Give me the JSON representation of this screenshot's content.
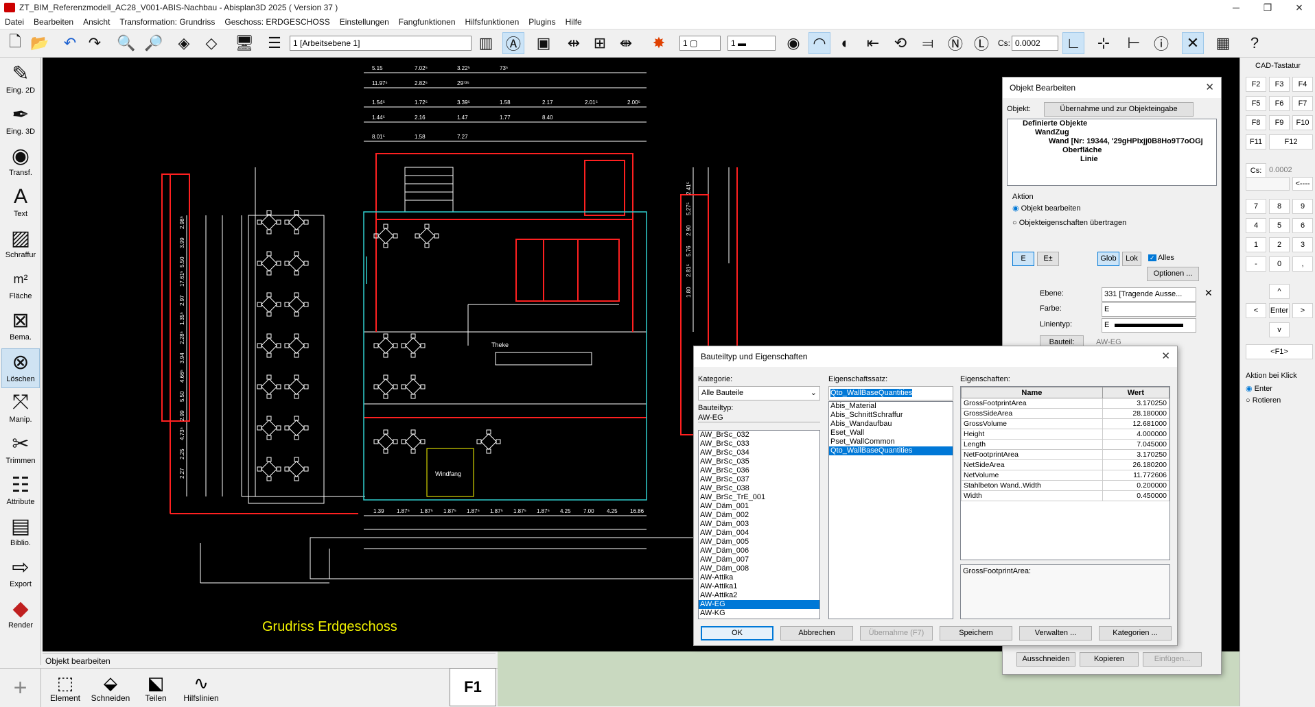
{
  "window": {
    "title": "ZT_BIM_Referenzmodell_AC28_V001-ABIS-Nachbau - Abisplan3D 2025 ( Version 37 )"
  },
  "menu": [
    "Datei",
    "Bearbeiten",
    "Ansicht",
    "Transformation: Grundriss",
    "Geschoss: ERDGESCHOSS",
    "Einstellungen",
    "Fangfunktionen",
    "Hilfsfunktionen",
    "Plugins",
    "Hilfe"
  ],
  "toolbar": {
    "layer_select": "1 [Arbeitsebene 1]",
    "pen_value": "1",
    "line_value": "1",
    "cs_label": "Cs:",
    "cs_value": "0.0002"
  },
  "left_palette": [
    {
      "label": "Eing. 2D",
      "icon": "pen-2d-icon"
    },
    {
      "label": "Eing. 3D",
      "icon": "pen-3d-icon"
    },
    {
      "label": "Transf.",
      "icon": "eye-icon"
    },
    {
      "label": "Text",
      "icon": "text-a-icon"
    },
    {
      "label": "Schraffur",
      "icon": "hatch-icon"
    },
    {
      "label": "Fläche",
      "icon": "area-m2-icon"
    },
    {
      "label": "Bema.",
      "icon": "dimension-icon"
    },
    {
      "label": "Löschen",
      "icon": "delete-x-icon"
    },
    {
      "label": "Manip.",
      "icon": "manipulate-icon"
    },
    {
      "label": "Trimmen",
      "icon": "scissors-icon"
    },
    {
      "label": "Attribute",
      "icon": "attribute-icon"
    },
    {
      "label": "Biblio.",
      "icon": "library-icon"
    },
    {
      "label": "Export",
      "icon": "export-icon"
    },
    {
      "label": "Render",
      "icon": "render-icon"
    }
  ],
  "drawing": {
    "title": "Grudriss Erdgeschoss",
    "dims_top": [
      "5.15",
      "7.02⁵",
      "3.22⁵",
      "73⁵",
      "11.97⁵",
      "2.82⁵",
      "29⁷³⁵",
      "1.54⁵",
      "1.72⁵",
      "3.39⁵",
      "1.58",
      "2.17",
      "2.01⁵",
      "2.00⁵",
      "1.44⁵",
      "2.16",
      "1.47",
      "1.77",
      "8.40",
      "8.01⁵",
      "1.58",
      "7.27"
    ],
    "dims_bottom": [
      "1.39",
      "1.87⁵",
      "1.87⁵",
      "1.87⁵",
      "1.87⁵",
      "1.87⁵",
      "1.87⁵",
      "1.87⁵",
      "4.25",
      "7.00",
      "4.25",
      "16.86"
    ],
    "dims_left": [
      "2.98⁵",
      "3.99",
      "5.50",
      "17.61⁵",
      "2.97",
      "1.35⁵",
      "2.28⁵",
      "3.94",
      "4.66⁵",
      "5.50",
      "2.99",
      "4.73⁵",
      "2.25",
      "2.27"
    ],
    "dims_right": [
      "2.41⁵",
      "5.27⁵",
      "2.90",
      "5.76",
      "2.81⁵",
      "1.80"
    ],
    "room_labels": [
      "Theke",
      "Windfang"
    ]
  },
  "status_text": "Objekt bearbeiten",
  "bottom_tools": [
    {
      "label": "Element",
      "icon": "element-icon"
    },
    {
      "label": "Schneiden",
      "icon": "cut-icon"
    },
    {
      "label": "Teilen",
      "icon": "split-icon"
    },
    {
      "label": "Hilfslinien",
      "icon": "guide-curve-icon"
    }
  ],
  "f1_label": "F1",
  "cad_keyboard": {
    "title": "CAD-Tastatur",
    "fkeys": [
      "F2",
      "F3",
      "F4",
      "F5",
      "F6",
      "F7",
      "F8",
      "F9",
      "F10",
      "F11",
      "F12"
    ],
    "cs_label": "Cs:",
    "cs_value": "0.0002",
    "back_label": "<----",
    "num": [
      "7",
      "8",
      "9",
      "4",
      "5",
      "6",
      "1",
      "2",
      "3",
      "-",
      "0",
      ","
    ],
    "up": "^",
    "left": "<",
    "enter": "Enter",
    "right": ">",
    "down": "v",
    "f1_key": "<F1>",
    "action_title": "Aktion bei Klick",
    "radio_enter": "Enter",
    "radio_rotate": "Rotieren"
  },
  "obj_dialog": {
    "title": "Objekt Bearbeiten",
    "obj_label": "Objekt:",
    "take_btn": "Übernahme und zur Objekteingabe",
    "tree": [
      "Definierte Objekte",
      "WandZug",
      "Wand [Nr: 19344, '29gHPIxjj0B8Ho9T7oOGj",
      "Oberfläche",
      "Linie"
    ],
    "aktion_label": "Aktion",
    "radio_edit": "Objekt bearbeiten",
    "radio_transfer": "Objekteigenschaften übertragen",
    "btn_e": "E",
    "btn_epm": "E±",
    "btn_glob": "Glob",
    "btn_lok": "Lok",
    "chk_alles": "Alles",
    "options_btn": "Optionen ...",
    "ebene_label": "Ebene:",
    "ebene_value": "331 [Tragende Ausse...",
    "farbe_label": "Farbe:",
    "farbe_value": "E",
    "linientyp_label": "Linientyp:",
    "linientyp_value": "E",
    "bauteil_btn": "Bauteil:",
    "bauteil_value": "AW-EG",
    "btn_cut": "Ausschneiden",
    "btn_copy": "Kopieren",
    "btn_paste": "Einfügen..."
  },
  "bt_dialog": {
    "title": "Bauteiltyp und Eigenschaften",
    "kat_label": "Kategorie:",
    "kat_value": "Alle Bauteile",
    "bt_label": "Bauteiltyp:",
    "bt_value": "AW-EG",
    "types": [
      "AW_BrSc_032",
      "AW_BrSc_033",
      "AW_BrSc_034",
      "AW_BrSc_035",
      "AW_BrSc_036",
      "AW_BrSc_037",
      "AW_BrSc_038",
      "AW_BrSc_TrE_001",
      "AW_Däm_001",
      "AW_Däm_002",
      "AW_Däm_003",
      "AW_Däm_004",
      "AW_Däm_005",
      "AW_Däm_006",
      "AW_Däm_007",
      "AW_Däm_008",
      "AW-Attika",
      "AW-Attika1",
      "AW-Attika2",
      "AW-EG",
      "AW-KG"
    ],
    "selected_type": "AW-EG",
    "set_label": "Eigenschaftssatz:",
    "set_value": "Qto_WallBaseQuantities",
    "sets": [
      "Abis_Material",
      "Abis_SchnittSchraffur",
      "Abis_Wandaufbau",
      "Eset_Wall",
      "Pset_WallCommon",
      "Qto_WallBaseQuantities"
    ],
    "selected_set": "Qto_WallBaseQuantities",
    "props_label": "Eigenschaften:",
    "col_name": "Name",
    "col_value": "Wert",
    "props": [
      {
        "name": "GrossFootprintArea",
        "value": "3.170250"
      },
      {
        "name": "GrossSideArea",
        "value": "28.180000"
      },
      {
        "name": "GrossVolume",
        "value": "12.681000"
      },
      {
        "name": "Height",
        "value": "4.000000"
      },
      {
        "name": "Length",
        "value": "7.045000"
      },
      {
        "name": "NetFootprintArea",
        "value": "3.170250"
      },
      {
        "name": "NetSideArea",
        "value": "26.180200"
      },
      {
        "name": "NetVolume",
        "value": "11.772606"
      },
      {
        "name": "Stahlbeton Wand..Width",
        "value": "0.200000"
      },
      {
        "name": "Width",
        "value": "0.450000"
      }
    ],
    "desc_text": "GrossFootprintArea:",
    "btn_ok": "OK",
    "btn_cancel": "Abbrechen",
    "btn_take": "Übernahme (F7)",
    "btn_save": "Speichern",
    "btn_manage": "Verwalten ...",
    "btn_categories": "Kategorien ..."
  },
  "colors": {
    "canvas": "#000000",
    "wall_red": "#ff2020",
    "line_white": "#ffffff",
    "cyan": "#30d0d0",
    "title_yellow": "#f0f000",
    "selected": "#0078d7"
  }
}
